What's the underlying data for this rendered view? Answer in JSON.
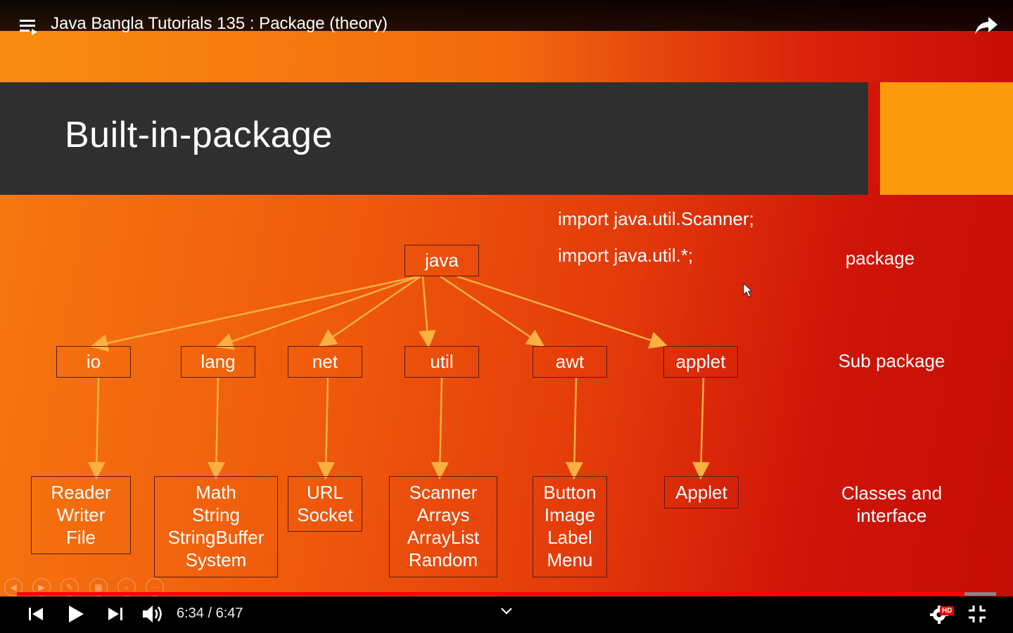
{
  "player": {
    "video_title": "Java Bangla Tutorials 135 : Package (theory)",
    "time_current": "6:34",
    "time_total": "6:47",
    "time_display": "6:34 / 6:47",
    "progress_fraction": 0.968,
    "hd_badge": "HD",
    "accent_color": "#ff0000"
  },
  "slide": {
    "title": "Built-in-package",
    "imports": [
      "import java.util.Scanner;",
      "import java.util.*;"
    ],
    "level_labels": {
      "package": "package",
      "sub_package": "Sub package",
      "classes_line1": "Classes and",
      "classes_line2": "interface"
    },
    "root": "java",
    "subpackages": [
      "io",
      "lang",
      "net",
      "util",
      "awt",
      "applet"
    ],
    "classes": [
      [
        "Reader",
        "Writer",
        "File"
      ],
      [
        "Math",
        "String",
        "StringBuffer",
        "System"
      ],
      [
        "URL",
        "Socket"
      ],
      [
        "Scanner",
        "Arrays",
        "ArrayList",
        "Random"
      ],
      [
        "Button",
        "Image",
        "Label",
        "Menu"
      ],
      [
        "Applet"
      ]
    ]
  }
}
